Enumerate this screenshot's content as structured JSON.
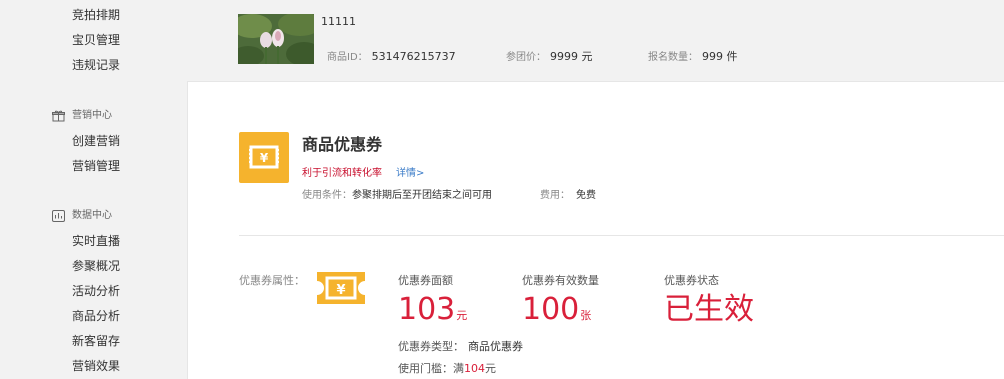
{
  "sidebar": {
    "items_top": [
      "竞拍排期",
      "宝贝管理",
      "违规记录"
    ],
    "group_marketing": {
      "label": "营销中心",
      "icon": "gift-icon",
      "items": [
        "创建营销",
        "营销管理"
      ]
    },
    "group_data": {
      "label": "数据中心",
      "icon": "chart-icon",
      "items": [
        "实时直播",
        "参聚概况",
        "活动分析",
        "商品分析",
        "新客留存",
        "营销效果"
      ]
    }
  },
  "product": {
    "name": "11111",
    "id_label": "商品ID：",
    "id_value": "531476215737",
    "price_label": "参团价：",
    "price_value": "9999 元",
    "signup_label": "报名数量：",
    "signup_value": "999 件"
  },
  "coupon": {
    "title": "商品优惠券",
    "benefit": "利于引流和转化率",
    "detail_link": "详情>",
    "condition_label": "使用条件：",
    "condition_value": "参聚排期后至开团结束之间可用",
    "fee_label": "费用：",
    "fee_value": "免费",
    "attr_label": "优惠券属性：",
    "face_label": "优惠券面额",
    "face_value": "103",
    "face_unit": "元",
    "count_label": "优惠券有效数量",
    "count_value": "100",
    "count_unit": "张",
    "status_label": "优惠券状态",
    "status_value": "已生效",
    "type_label": "优惠券类型：",
    "type_value": "商品优惠券",
    "threshold_label": "使用门槛：满",
    "threshold_value": "104",
    "threshold_unit": "元"
  },
  "colors": {
    "accent_red": "#d9203a",
    "badge_yellow": "#f5b32d",
    "link_blue": "#3a7bc8"
  }
}
